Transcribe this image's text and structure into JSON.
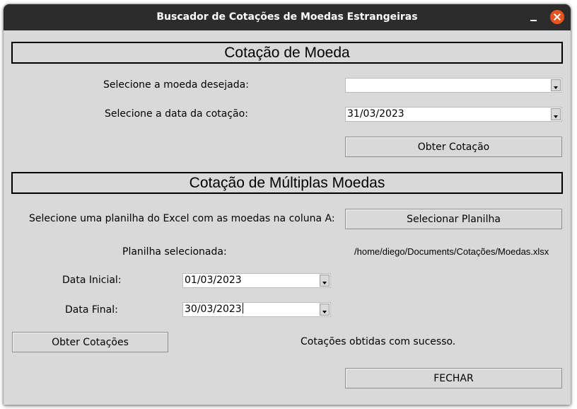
{
  "window": {
    "title": "Buscador de Cotações de Moedas Estrangeiras"
  },
  "single": {
    "header": "Cotação de Moeda",
    "currency_label": "Selecione a moeda desejada:",
    "currency_value": "",
    "date_label": "Selecione a data da cotação:",
    "date_value": "31/03/2023",
    "get_button": "Obter Cotação"
  },
  "multi": {
    "header": "Cotação de Múltiplas Moedas",
    "select_label": "Selecione uma planilha do Excel com as moedas na coluna A:",
    "select_button": "Selecionar Planilha",
    "selected_label": "Planilha selecionada:",
    "selected_path": "/home/diego/Documents/Cotações/Moedas.xlsx",
    "start_label": "Data Inicial:",
    "start_value": "01/03/2023",
    "end_label": "Data Final:",
    "end_value": "30/03/2023",
    "get_button": "Obter Cotações",
    "status": "Cotações obtidas com sucesso."
  },
  "close_button": "FECHAR",
  "icons": {
    "minimize": "minimize-icon",
    "close": "close-icon",
    "dropdown": "chevron-down-icon"
  },
  "colors": {
    "titlebar": "#2c2c2c",
    "window_bg": "#d9d9d9",
    "close_accent": "#e95420"
  }
}
